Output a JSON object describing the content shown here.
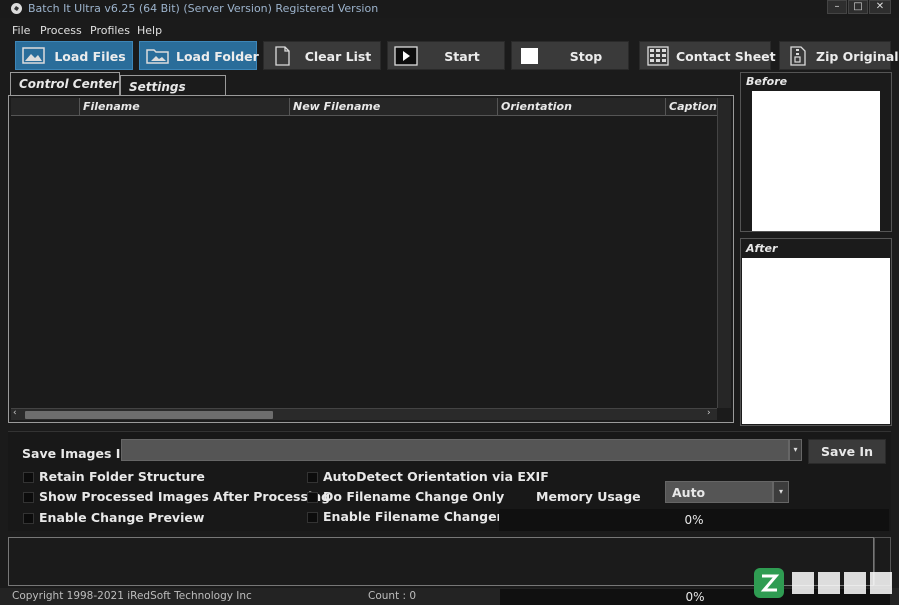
{
  "window": {
    "title": "Batch It Ultra v6.25 (64 Bit) (Server Version) Registered Version",
    "controls": [
      "–",
      "□",
      "✕"
    ]
  },
  "menu": [
    "File",
    "Process",
    "Profiles",
    "Help"
  ],
  "toolbar": {
    "load_files": "Load Files",
    "load_folder": "Load Folder",
    "clear_list": "Clear List",
    "start": "Start",
    "stop": "Stop",
    "contact_sheet": "Contact Sheet",
    "zip_original": "Zip Original"
  },
  "tabs": {
    "control_center": "Control Center",
    "settings": "Settings"
  },
  "file_list": {
    "columns": [
      "Filename",
      "New Filename",
      "Orientation",
      "Caption"
    ],
    "scroll_left": "‹",
    "scroll_right": "›"
  },
  "preview": {
    "before": "Before",
    "after": "After"
  },
  "save": {
    "label": "Save Images In",
    "value": "",
    "dropdown_arrow": "▾",
    "button": "Save In"
  },
  "options": {
    "retain_folder_structure": "Retain Folder Structure",
    "show_processed": "Show Processed Images After Processing",
    "enable_change_preview": "Enable Change Preview",
    "autodetect_orientation": "AutoDetect Orientation via EXIF",
    "filename_change_only": "Do Filename Change Only",
    "enable_filename_changer": "Enable Filename Changer"
  },
  "memory": {
    "label": "Memory Usage",
    "value": "Auto",
    "dropdown_arrow": "▾"
  },
  "progress": {
    "text": "0%",
    "value": 0
  },
  "status": {
    "copyright": "Copyright 1998-2021 iRedSoft Technology Inc",
    "count": "Count : 0",
    "progress_text": "0%"
  },
  "colors": {
    "background": "#1b1b1b",
    "active_button": "#2a6d9a",
    "button": "#3a3a3a",
    "input": "#555555"
  }
}
